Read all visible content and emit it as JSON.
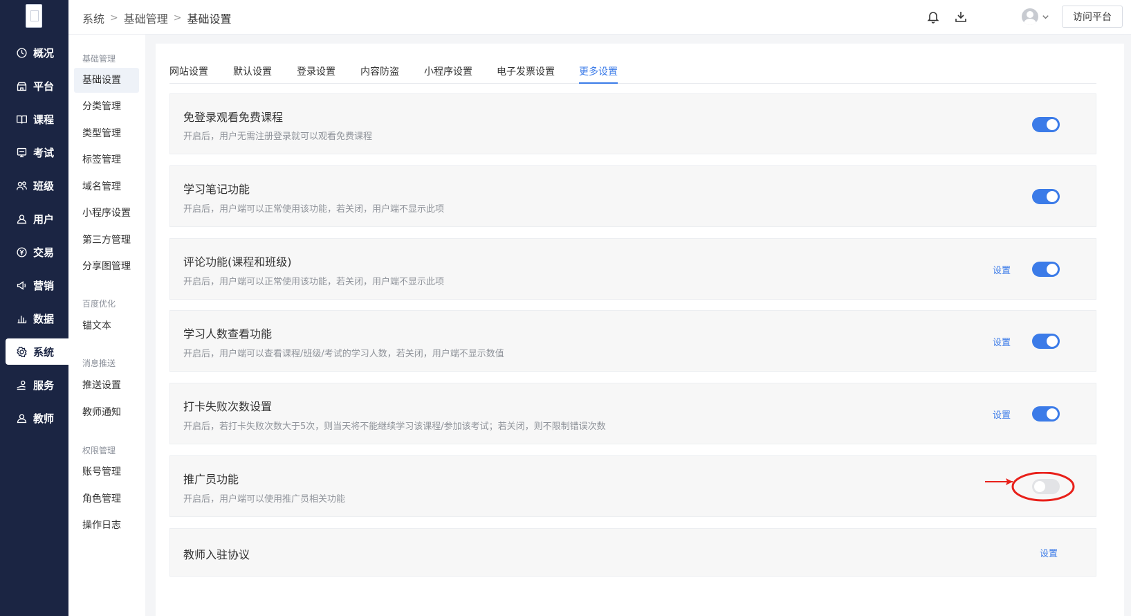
{
  "sidebar": {
    "items": [
      {
        "label": "概况",
        "icon": "clock-icon"
      },
      {
        "label": "平台",
        "icon": "store-icon"
      },
      {
        "label": "课程",
        "icon": "book-icon"
      },
      {
        "label": "考试",
        "icon": "exam-icon"
      },
      {
        "label": "班级",
        "icon": "group-icon"
      },
      {
        "label": "用户",
        "icon": "user-icon"
      },
      {
        "label": "交易",
        "icon": "yen-icon"
      },
      {
        "label": "营销",
        "icon": "megaphone-icon"
      },
      {
        "label": "数据",
        "icon": "bar-chart-icon"
      },
      {
        "label": "系统",
        "icon": "gear-icon",
        "active": true
      },
      {
        "label": "服务",
        "icon": "service-icon"
      },
      {
        "label": "教师",
        "icon": "teacher-icon"
      }
    ]
  },
  "subnav": {
    "groups": [
      {
        "title": "基础管理",
        "items": [
          "基础设置",
          "分类管理",
          "类型管理",
          "标签管理",
          "域名管理",
          "小程序设置",
          "第三方管理",
          "分享图管理"
        ]
      },
      {
        "title": "百度优化",
        "items": [
          "锚文本"
        ]
      },
      {
        "title": "消息推送",
        "items": [
          "推送设置",
          "教师通知"
        ]
      },
      {
        "title": "权限管理",
        "items": [
          "账号管理",
          "角色管理",
          "操作日志"
        ]
      }
    ],
    "active": "基础设置"
  },
  "header": {
    "breadcrumb": [
      "系统",
      "基础管理",
      "基础设置"
    ],
    "breadcrumb_sep": ">",
    "visit_label": "访问平台"
  },
  "tabs": [
    "网站设置",
    "默认设置",
    "登录设置",
    "内容防盗",
    "小程序设置",
    "电子发票设置",
    "更多设置"
  ],
  "active_tab": "更多设置",
  "settings": [
    {
      "title": "免登录观看免费课程",
      "desc": "开启后，用户无需注册登录就可以观看免费课程",
      "link": "",
      "enabled": true
    },
    {
      "title": "学习笔记功能",
      "desc": "开启后，用户端可以正常使用该功能，若关闭，用户端不显示此项",
      "link": "",
      "enabled": true
    },
    {
      "title": "评论功能(课程和班级)",
      "desc": "开启后，用户端可以正常使用该功能，若关闭，用户端不显示此项",
      "link": "设置",
      "enabled": true
    },
    {
      "title": "学习人数查看功能",
      "desc": "开启后，用户端可以查看课程/班级/考试的学习人数，若关闭，用户端不显示数值",
      "link": "设置",
      "enabled": true
    },
    {
      "title": "打卡失败次数设置",
      "desc": "开启后，若打卡失败次数大于5次，则当天将不能继续学习该课程/参加该考试；若关闭，则不限制错误次数",
      "link": "设置",
      "enabled": true
    },
    {
      "title": "推广员功能",
      "desc": "开启后，用户端可以使用推广员相关功能",
      "link": "",
      "enabled": false
    },
    {
      "title": "教师入驻协议",
      "desc": "",
      "link": "设置",
      "enabled": null
    }
  ],
  "colors": {
    "sidebar_bg": "#1b2543",
    "accent": "#3b7be8",
    "annotation": "#e8201a"
  }
}
